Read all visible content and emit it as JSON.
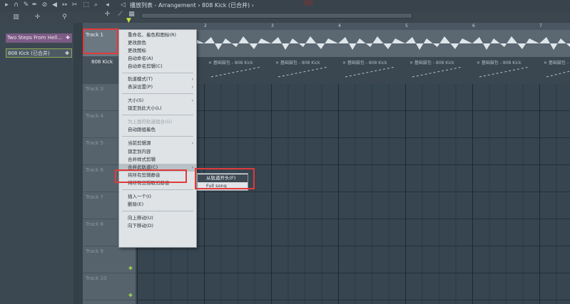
{
  "header": {
    "crumb": "播放列表 - Arrangement › 808 Kick (已合并) ›"
  },
  "left_panel": {
    "patterns": [
      "Two Steps From Hell...",
      "808 Kick (已合并)"
    ]
  },
  "ruler": {
    "bars": [
      "2",
      "3",
      "4",
      "5",
      "6",
      "7"
    ]
  },
  "tracks": {
    "t1": "Track 1",
    "t2": "808 Kick",
    "rest": [
      "Track 3",
      "Track 4",
      "Track 5",
      "Track 6",
      "Track 7",
      "Track 8",
      "Track 9",
      "Track 10"
    ]
  },
  "clip_label": "✕ 基础鼓包 - 808 Kick",
  "context_menu": {
    "items": [
      {
        "label": "重命名、着色和图标(R)",
        "arrow": false
      },
      {
        "label": "更改颜色",
        "arrow": false
      },
      {
        "label": "更改图标",
        "arrow": false
      },
      {
        "label": "自动命名(A)",
        "arrow": false
      },
      {
        "label": "自动命名剪辑(C)",
        "arrow": false
      },
      {
        "label": "轨道模式(T)",
        "arrow": true
      },
      {
        "label": "表演设置(P)",
        "arrow": true
      },
      {
        "label": "大小(S)",
        "arrow": true
      },
      {
        "label": "锁定到此大小(L)",
        "arrow": false
      },
      {
        "label": "为上面的轨道组合(G)",
        "arrow": false,
        "disabled": true
      },
      {
        "label": "自动跟组着色",
        "arrow": false
      },
      {
        "label": "当前剪辑源",
        "arrow": true
      },
      {
        "label": "锁定到内容",
        "arrow": false
      },
      {
        "label": "合并样式剪辑",
        "arrow": false
      },
      {
        "label": "合并此轨道(C)",
        "arrow": true
      },
      {
        "label": "将所有剪辑静音",
        "arrow": false
      },
      {
        "label": "将所有剪辑取消静音",
        "arrow": false
      },
      {
        "label": "插入一个(I)",
        "arrow": false
      },
      {
        "label": "删除(E)",
        "arrow": false
      },
      {
        "label": "向上移动(U)",
        "arrow": false
      },
      {
        "label": "向下移动(D)",
        "arrow": false
      }
    ]
  },
  "submenu": {
    "items": [
      "从轨道开头(F)",
      "Full song"
    ]
  },
  "colors": {
    "highlight_red": "#e23a3a",
    "plus_green": "#a7e24a"
  }
}
